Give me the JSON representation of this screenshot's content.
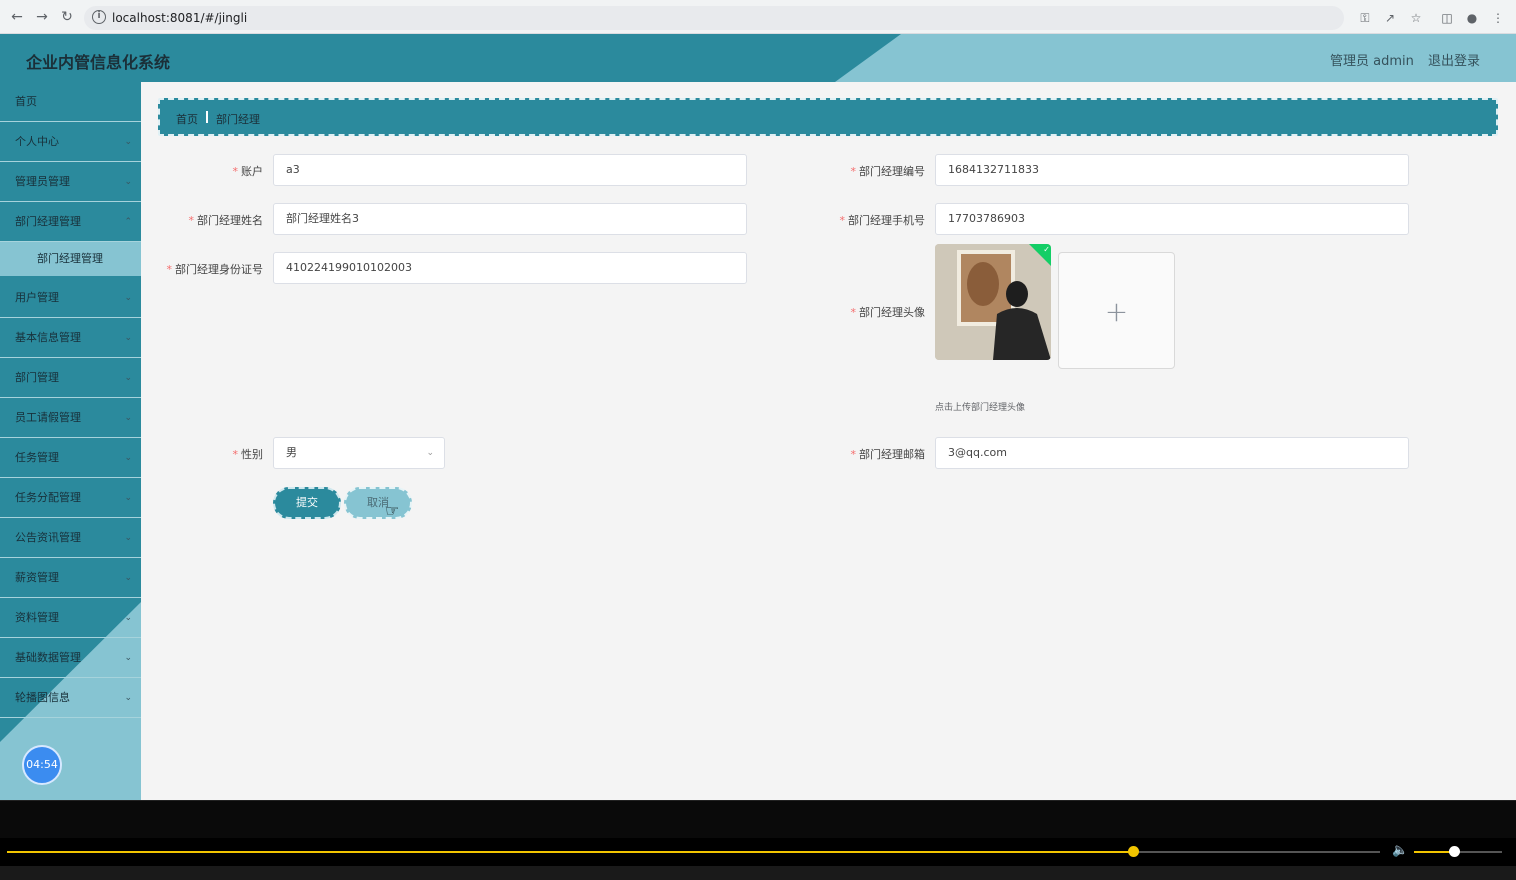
{
  "browser": {
    "url": "localhost:8081/#/jingli"
  },
  "header": {
    "title": "企业内管信息化系统",
    "user": "管理员 admin",
    "logout": "退出登录"
  },
  "sidebar": {
    "items": [
      {
        "label": "首页"
      },
      {
        "label": "个人中心"
      },
      {
        "label": "管理员管理"
      },
      {
        "label": "部门经理管理"
      },
      {
        "label": "部门经理管理"
      },
      {
        "label": "用户管理"
      },
      {
        "label": "基本信息管理"
      },
      {
        "label": "部门管理"
      },
      {
        "label": "员工请假管理"
      },
      {
        "label": "任务管理"
      },
      {
        "label": "任务分配管理"
      },
      {
        "label": "公告资讯管理"
      },
      {
        "label": "薪资管理"
      },
      {
        "label": "资料管理"
      },
      {
        "label": "基础数据管理"
      },
      {
        "label": "轮播图信息"
      }
    ],
    "timer": "04:54"
  },
  "breadcrumb": {
    "home": "首页",
    "current": "部门经理"
  },
  "form": {
    "account_label": "账户",
    "account_value": "a3",
    "number_label": "部门经理编号",
    "number_value": "1684132711833",
    "name_label": "部门经理姓名",
    "name_value": "部门经理姓名3",
    "phone_label": "部门经理手机号",
    "phone_value": "17703786903",
    "id_label": "部门经理身份证号",
    "id_value": "410224199010102003",
    "avatar_label": "部门经理头像",
    "upload_plus": "+",
    "upload_tip": "点击上传部门经理头像",
    "gender_label": "性别",
    "gender_value": "男",
    "email_label": "部门经理邮箱",
    "email_value": "3@qq.com",
    "submit": "提交",
    "cancel": "取消"
  },
  "player": {
    "progress": 0.82,
    "volume": 0.45
  },
  "colors": {
    "primary": "#2b8a9d",
    "light": "#86c4d2",
    "required": "#f56c6c",
    "progress": "#f2c500"
  }
}
